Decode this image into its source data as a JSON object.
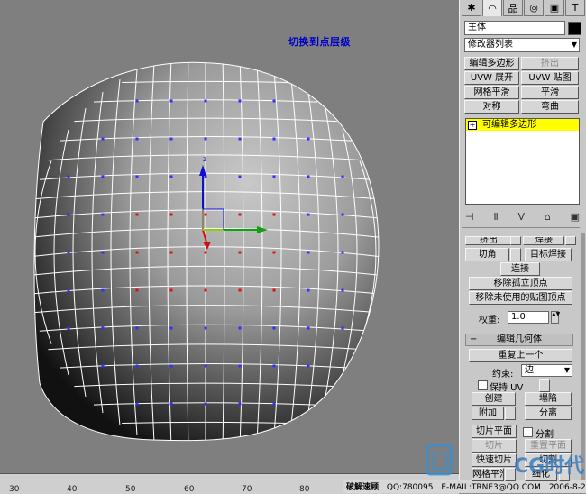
{
  "viewport": {
    "caption": "切换到点层级",
    "axis_label_z": "z"
  },
  "ruler": {
    "ticks": [
      "30",
      "40",
      "50",
      "60",
      "70",
      "80"
    ]
  },
  "status": {
    "left": "破解速顾",
    "qq": "QQ:780095",
    "email": "E-MAIL:TRNE3@QQ.COM",
    "date": "2006-8-25"
  },
  "watermark": {
    "text": "CG时代"
  },
  "cmd": {
    "tabs": [
      "create-icon",
      "modify-icon",
      "hierarchy-icon",
      "motion-icon",
      "display-icon",
      "utilities-icon"
    ],
    "object_name": "主体",
    "object_color": "#000000",
    "modifier_list": "修改器列表",
    "buttons": {
      "edit_poly": "编辑多边形",
      "extrude": "挤出",
      "uvw_unwrap": "UVW 展开",
      "uvw_map": "UVW 贴图",
      "meshsmooth": "网格平滑",
      "smooth": "平滑",
      "symmetry": "对称",
      "bend": "弯曲"
    },
    "stack_item": "可编辑多边形",
    "rollout": {
      "extrude": "挤出",
      "weld": "焊接",
      "chamfer": "切角",
      "target_weld": "目标焊接",
      "connect": "连接",
      "remove_isolated": "移除孤立顶点",
      "remove_unused": "移除未使用的贴图顶点",
      "weight_label": "权重:",
      "weight_value": "1.0",
      "edit_geometry": "编辑几何体",
      "repeat_last": "重复上一个",
      "constraint_label": "约束:",
      "constraint_value": "边",
      "preserve_uv": "保持 UV",
      "create": "创建",
      "collapse": "塌陷",
      "attach": "附加",
      "detach": "分离",
      "slice_plane": "切片平面",
      "split": "分割",
      "slice": "切片",
      "reset_plane": "重置平面",
      "quickslice": "快速切片",
      "cut": "切割",
      "msmooth": "网格平滑",
      "tessellate": "细化"
    }
  }
}
